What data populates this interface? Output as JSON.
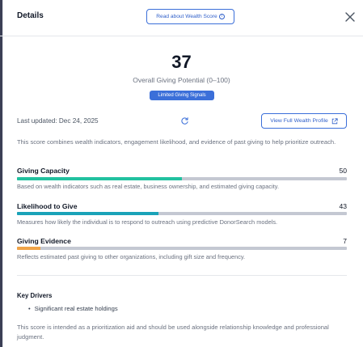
{
  "header": {
    "title": "Details",
    "read_button_label": "Read about Wealth Score",
    "info_icon_glyph": "i",
    "close_icon": "close-icon"
  },
  "score": {
    "value": "37",
    "caption": "Overall Giving Potential (0–100)",
    "badge": "Limited Giving Signals"
  },
  "meta": {
    "last_updated": "Last updated: Dec 24, 2025",
    "refresh_icon": "refresh-icon",
    "profile_button_label": "View Full Wealth Profile",
    "external_link_icon": "external-link-icon"
  },
  "description": "This score combines wealth indicators, engagement likelihood, and evidence of past giving to help prioritize outreach.",
  "metrics": [
    {
      "label": "Giving Capacity",
      "value": "50",
      "fill_fraction": 0.5,
      "color": "#22c1a0",
      "description": "Based on wealth indicators such as real estate, business ownership, and estimated giving capacity."
    },
    {
      "label": "Likelihood to Give",
      "value": "43",
      "fill_fraction": 0.43,
      "color": "#1aa3b8",
      "description": "Measures how likely the individual is to respond to outreach using predictive DonorSearch models."
    },
    {
      "label": "Giving Evidence",
      "value": "7",
      "fill_fraction": 0.07,
      "color": "#f0a448",
      "description": "Reflects estimated past giving to other organizations, including gift size and frequency."
    }
  ],
  "key_drivers": {
    "title": "Key Drivers",
    "items": [
      "Significant real estate holdings"
    ]
  },
  "footer_note": "This score is intended as a prioritization aid and should be used alongside relationship knowledge and professional judgment."
}
